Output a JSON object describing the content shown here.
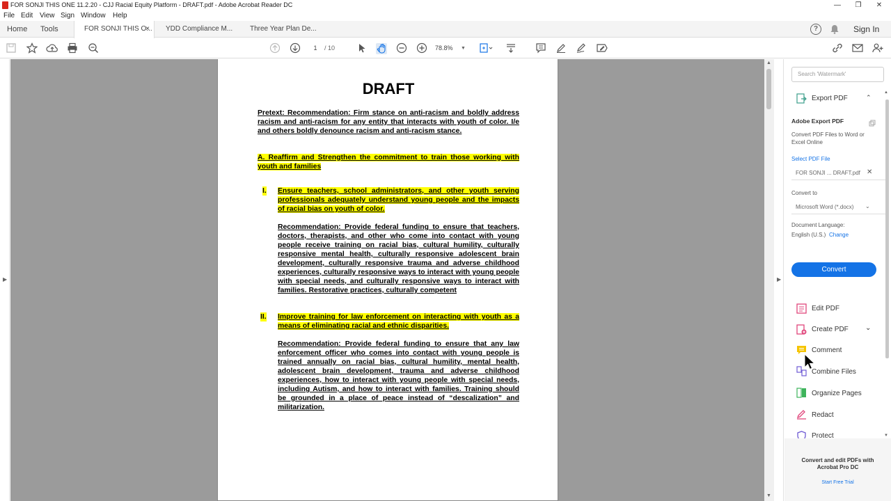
{
  "window": {
    "title": "FOR SONJI THIS ONE 11.2.20 - CJJ Racial Equity Platform - DRAFT.pdf - Adobe Acrobat Reader DC",
    "minimize": "—",
    "restore": "❐",
    "close": "✕"
  },
  "menu": [
    "File",
    "Edit",
    "View",
    "Sign",
    "Window",
    "Help"
  ],
  "tabs": {
    "home": "Home",
    "tools": "Tools",
    "doc1": "FOR SONJI THIS O...",
    "doc2": "YDD Compliance M...",
    "doc3": "Three Year Plan De...",
    "close": "×",
    "help_icon": "?",
    "sign_in": "Sign In"
  },
  "toolbar": {
    "page_current": "1",
    "page_total": "/ 10",
    "zoom": "78.8%"
  },
  "document": {
    "heading": "DRAFT",
    "pretext": "Pretext: Recommendation: Firm stance on anti-racism and boldly address racism and anti-racism for any entity that interacts with youth of color. I/e and others boldly denounce racism and anti-racism stance.",
    "section_a": "A. Reaffirm and Strengthen the commitment to train those working with youth and families",
    "item1_num": "I.",
    "item1_title": "Ensure teachers, school administrators, and other youth serving professionals adequately understand young people and the impacts of racial bias on youth of color.",
    "item1_rec": "Recommendation: Provide federal funding to ensure that teachers, doctors, therapists, and other who come into contact with young people receive training on racial bias, cultural humility, culturally responsive mental health, culturally responsive adolescent brain development, culturally responsive trauma and adverse childhood experiences, culturally responsive ways to interact with young people with special needs, and culturally responsive ways to interact with families. Restorative practices, culturally competent",
    "item2_num": "II.",
    "item2_title": "Improve training for law enforcement on interacting with youth as a means of eliminating racial and ethnic disparities.",
    "item2_rec": "Recommendation: Provide federal funding to ensure that any law enforcement officer who comes into contact with young people is trained annually on racial bias, cultural humility, mental health, adolescent brain development, trauma and adverse childhood experiences, how to interact with young people with special needs, including Autism, and how to interact with families. Training should be grounded in a place of peace instead of “descalization” and militarization."
  },
  "right_panel": {
    "search_placeholder": "Search 'Watermark'",
    "export_pdf": "Export PDF",
    "adobe_export_title": "Adobe Export PDF",
    "adobe_export_desc": "Convert PDF Files to Word or Excel Online",
    "select_pdf_label": "Select PDF File",
    "selected_file": "FOR SONJI ... DRAFT.pdf",
    "convert_to_label": "Convert to",
    "convert_to_value": "Microsoft Word (*.docx)",
    "doc_language_label": "Document Language:",
    "doc_language_value": "English (U.S.)",
    "change_link": "Change",
    "convert_button": "Convert",
    "tools": [
      {
        "label": "Edit PDF",
        "color": "#e0457b"
      },
      {
        "label": "Create PDF",
        "color": "#e0457b"
      },
      {
        "label": "Comment",
        "color": "#f5c400"
      },
      {
        "label": "Combine Files",
        "color": "#6f5bd4"
      },
      {
        "label": "Organize Pages",
        "color": "#3db35a"
      },
      {
        "label": "Redact",
        "color": "#e0457b"
      },
      {
        "label": "Protect",
        "color": "#6f5bd4"
      }
    ],
    "footer_title": "Convert and edit PDFs with Acrobat Pro DC",
    "footer_link": "Start Free Trial"
  },
  "colors": {
    "highlight": "#ffff00",
    "accent": "#1473e6",
    "doc_background": "#9b9b9b"
  }
}
